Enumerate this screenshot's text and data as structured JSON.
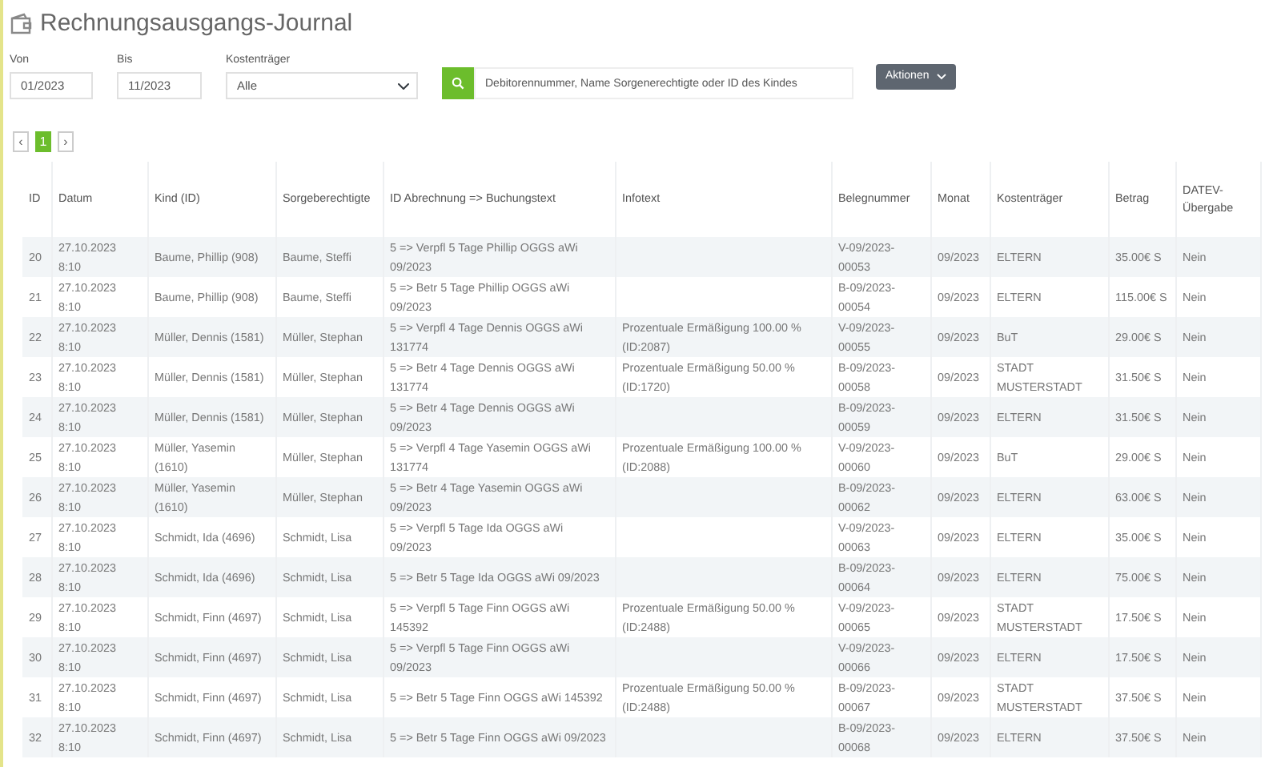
{
  "title": "Rechnungsausgangs-Journal",
  "filters": [
    {
      "kind": "input",
      "label": "Von",
      "value": "01/2023"
    },
    {
      "kind": "input",
      "label": "Bis",
      "value": "11/2023"
    },
    {
      "kind": "select",
      "label": "Kostenträger",
      "value": "Alle"
    }
  ],
  "search": {
    "placeholder": "Debitorennummer, Name Sorgenerechtigte oder ID des Kindes"
  },
  "actions_button": "Aktionen",
  "pagination": {
    "prev": "‹",
    "pages": [
      {
        "label": "1",
        "selected": true
      }
    ],
    "next": "›"
  },
  "table": {
    "columns": [
      "ID",
      "Datum",
      "Kind (ID)",
      "Sorgeberechtigte",
      "ID Abrechnung => Buchungstext",
      "Infotext",
      "Belegnummer",
      "Monat",
      "Kostenträger",
      "Betrag",
      "DATEV-Übergabe"
    ],
    "rows": [
      [
        "20",
        "27.10.2023 8:10",
        "Baume, Phillip (908)",
        "Baume, Steffi",
        "5 => Verpfl 5 Tage Phillip OGGS aWi 09/2023",
        "",
        "V-09/2023-00053",
        "09/2023",
        "ELTERN",
        "35.00€ S",
        "Nein"
      ],
      [
        "21",
        "27.10.2023 8:10",
        "Baume, Phillip (908)",
        "Baume, Steffi",
        "5 => Betr 5 Tage Phillip OGGS aWi 09/2023",
        "",
        "B-09/2023-00054",
        "09/2023",
        "ELTERN",
        "115.00€ S",
        "Nein"
      ],
      [
        "22",
        "27.10.2023 8:10",
        "Müller, Dennis (1581)",
        "Müller, Stephan",
        "5 => Verpfl 4 Tage Dennis OGGS aWi 131774",
        "Prozentuale Ermäßigung 100.00 % (ID:2087)",
        "V-09/2023-00055",
        "09/2023",
        "BuT",
        "29.00€ S",
        "Nein"
      ],
      [
        "23",
        "27.10.2023 8:10",
        "Müller, Dennis (1581)",
        "Müller, Stephan",
        "5 => Betr 4 Tage Dennis OGGS aWi 131774",
        "Prozentuale Ermäßigung 50.00 % (ID:1720)",
        "B-09/2023-00058",
        "09/2023",
        "STADT MUSTERSTADT",
        "31.50€ S",
        "Nein"
      ],
      [
        "24",
        "27.10.2023 8:10",
        "Müller, Dennis (1581)",
        "Müller, Stephan",
        "5 => Betr 4 Tage Dennis OGGS aWi 09/2023",
        "",
        "B-09/2023-00059",
        "09/2023",
        "ELTERN",
        "31.50€ S",
        "Nein"
      ],
      [
        "25",
        "27.10.2023 8:10",
        "Müller, Yasemin (1610)",
        "Müller, Stephan",
        "5 => Verpfl 4 Tage Yasemin OGGS aWi 131774",
        "Prozentuale Ermäßigung 100.00 % (ID:2088)",
        "V-09/2023-00060",
        "09/2023",
        "BuT",
        "29.00€ S",
        "Nein"
      ],
      [
        "26",
        "27.10.2023 8:10",
        "Müller, Yasemin (1610)",
        "Müller, Stephan",
        "5 => Betr 4 Tage Yasemin OGGS aWi 09/2023",
        "",
        "B-09/2023-00062",
        "09/2023",
        "ELTERN",
        "63.00€ S",
        "Nein"
      ],
      [
        "27",
        "27.10.2023 8:10",
        "Schmidt, Ida (4696)",
        "Schmidt, Lisa",
        "5 => Verpfl 5 Tage Ida OGGS aWi 09/2023",
        "",
        "V-09/2023-00063",
        "09/2023",
        "ELTERN",
        "35.00€ S",
        "Nein"
      ],
      [
        "28",
        "27.10.2023 8:10",
        "Schmidt, Ida (4696)",
        "Schmidt, Lisa",
        "5 => Betr 5 Tage Ida OGGS aWi 09/2023",
        "",
        "B-09/2023-00064",
        "09/2023",
        "ELTERN",
        "75.00€ S",
        "Nein"
      ],
      [
        "29",
        "27.10.2023 8:10",
        "Schmidt, Finn (4697)",
        "Schmidt, Lisa",
        "5 => Verpfl 5 Tage Finn OGGS aWi 145392",
        "Prozentuale Ermäßigung 50.00 % (ID:2488)",
        "V-09/2023-00065",
        "09/2023",
        "STADT MUSTERSTADT",
        "17.50€ S",
        "Nein"
      ],
      [
        "30",
        "27.10.2023 8:10",
        "Schmidt, Finn (4697)",
        "Schmidt, Lisa",
        "5 => Verpfl 5 Tage Finn OGGS aWi 09/2023",
        "",
        "V-09/2023-00066",
        "09/2023",
        "ELTERN",
        "17.50€ S",
        "Nein"
      ],
      [
        "31",
        "27.10.2023 8:10",
        "Schmidt, Finn (4697)",
        "Schmidt, Lisa",
        "5 => Betr 5 Tage Finn OGGS aWi 145392",
        "Prozentuale Ermäßigung 50.00 % (ID:2488)",
        "B-09/2023-00067",
        "09/2023",
        "STADT MUSTERSTADT",
        "37.50€ S",
        "Nein"
      ],
      [
        "32",
        "27.10.2023 8:10",
        "Schmidt, Finn (4697)",
        "Schmidt, Lisa",
        "5 => Betr 5 Tage Finn OGGS aWi 09/2023",
        "",
        "B-09/2023-00068",
        "09/2023",
        "ELTERN",
        "37.50€ S",
        "Nein"
      ]
    ]
  }
}
